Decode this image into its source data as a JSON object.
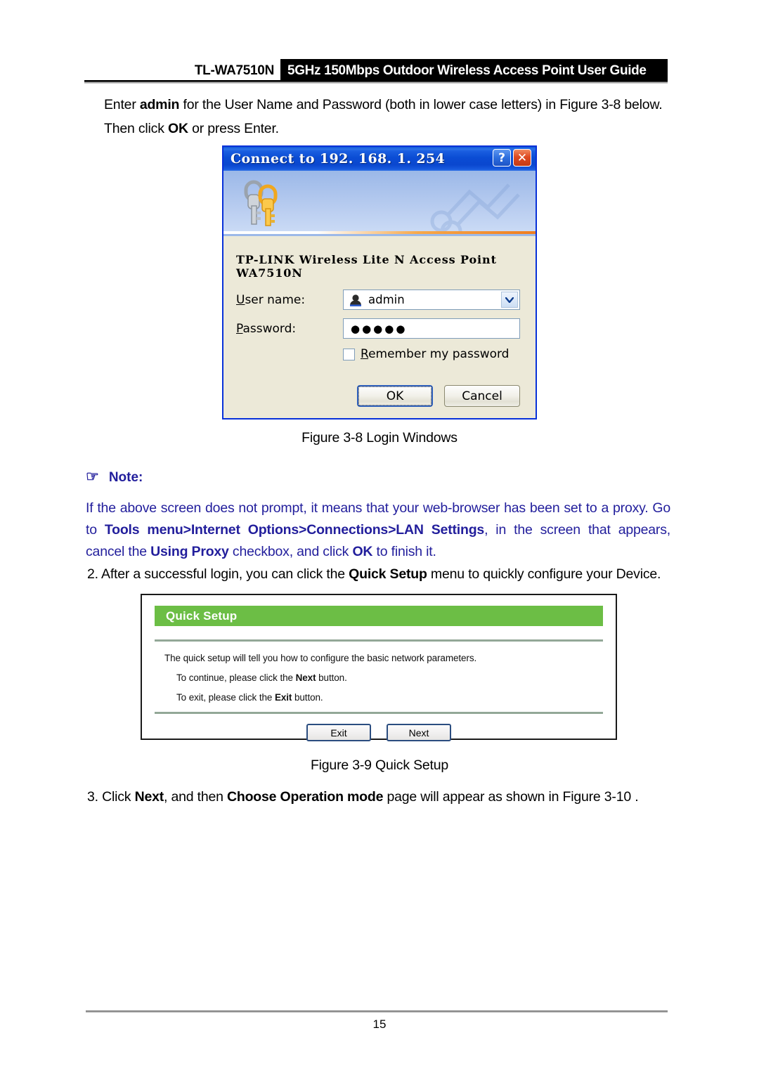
{
  "header": {
    "model": "TL-WA7510N",
    "banner_title": "5GHz 150Mbps Outdoor Wireless Access Point User Guide"
  },
  "intro": {
    "text_1": "Enter ",
    "bold_1": "admin",
    "text_2": " for the User Name and Password (both in lower case letters) in Figure 3-8 below. Then click ",
    "bold_2": "OK",
    "text_3": " or press Enter."
  },
  "login_dialog": {
    "title": "Connect to 192. 168. 1. 254",
    "help_button": "?",
    "close_button": "✕",
    "keys_icon": "keys-icon",
    "realm": "TP-LINK Wireless Lite N Access Point WA7510N",
    "username_label": "User name:",
    "username_value": "admin",
    "username_icon": "user-icon",
    "dropdown_icon": "chevron-down-icon",
    "password_label": "Password:",
    "password_value": "●●●●●",
    "remember_label": "Remember my password",
    "remember_checked": false,
    "ok_label": "OK",
    "cancel_label": "Cancel"
  },
  "figure_38_caption": "Figure 3-8 Login Windows",
  "note": {
    "hand_icon": "☞",
    "heading": "Note:",
    "line_1": "If the above screen does not prompt, it means that your web-browser has been set to a proxy. Go to ",
    "bold_1": "Tools menu>Internet Options>Connections>LAN Settings",
    "line_2": ", in the screen that appears, cancel the ",
    "bold_2": "Using Proxy",
    "line_3": " checkbox, and click ",
    "bold_3": "OK",
    "line_4": " to finish it.",
    "color": "#221e9c"
  },
  "step2": {
    "number": "2.",
    "text_1": " After a successful login, you can click the ",
    "bold_1": "Quick Setup",
    "text_2": " menu to quickly configure your Device."
  },
  "quick_setup": {
    "panel_title": "Quick Setup",
    "accent_color": "#6cbe45",
    "line_1": "The quick setup will tell you how to configure the basic network parameters.",
    "line_2_a": "To continue, please click the ",
    "line_2_bold": "Next",
    "line_2_b": " button.",
    "line_3_a": "To exit, please click the ",
    "line_3_bold": "Exit",
    "line_3_b": "  button.",
    "exit_label": "Exit",
    "next_label": "Next"
  },
  "figure_39_caption": "Figure 3-9 Quick Setup",
  "step3": {
    "number": "3.",
    "text_1": " Click ",
    "bold_1": "Next",
    "text_2": ", and then ",
    "bold_2": "Choose Operation mode",
    "text_3": " page will appear as shown in Figure 3-10 ."
  },
  "footer": {
    "page_number": "15"
  }
}
